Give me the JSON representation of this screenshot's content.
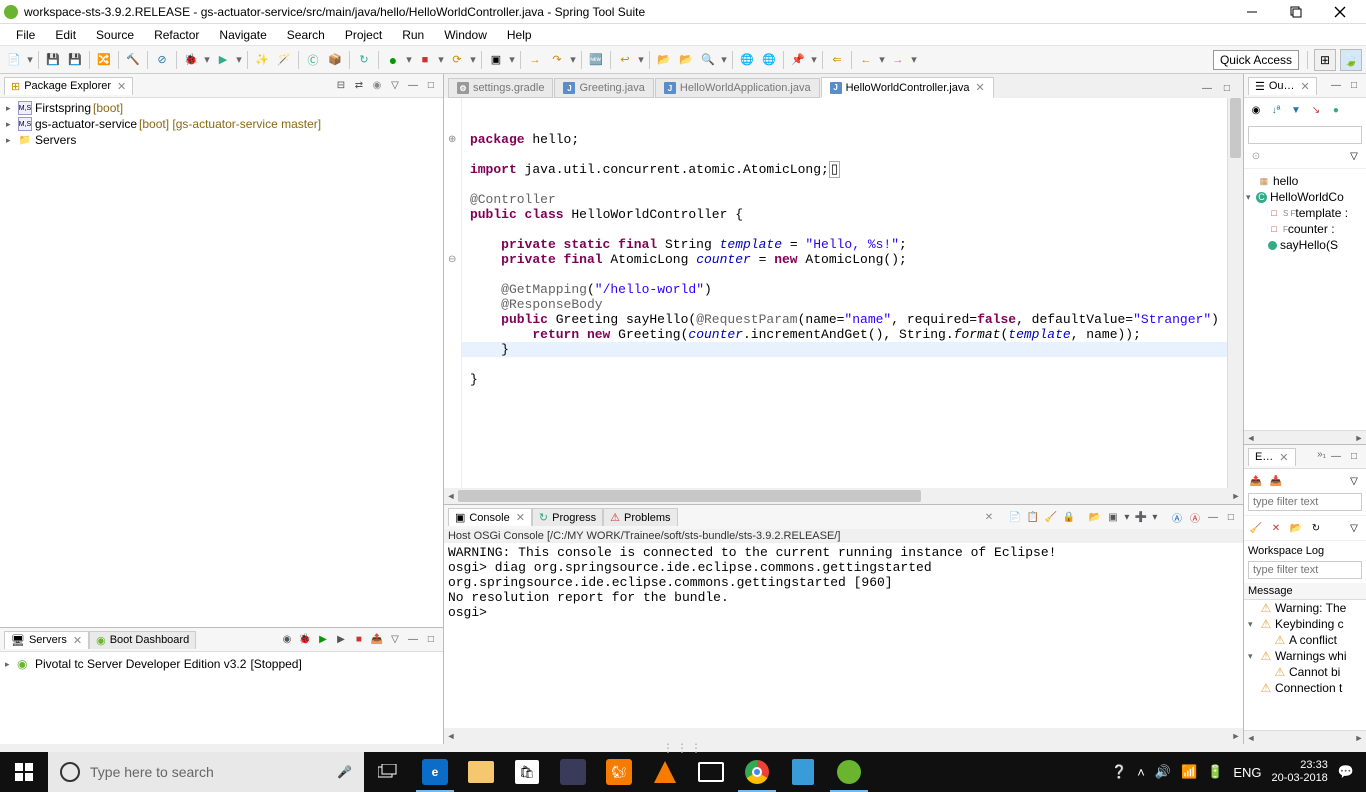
{
  "window": {
    "title": "workspace-sts-3.9.2.RELEASE - gs-actuator-service/src/main/java/hello/HelloWorldController.java - Spring Tool Suite"
  },
  "menu": [
    "File",
    "Edit",
    "Source",
    "Refactor",
    "Navigate",
    "Search",
    "Project",
    "Run",
    "Window",
    "Help"
  ],
  "quick_access": "Quick Access",
  "package_explorer": {
    "title": "Package Explorer",
    "items": [
      {
        "label": "Firstspring",
        "decorator": "[boot]"
      },
      {
        "label": "gs-actuator-service",
        "decorator": "[boot] [gs-actuator-service master]"
      },
      {
        "label": "Servers",
        "decorator": ""
      }
    ]
  },
  "servers_panel": {
    "tabs": [
      "Servers",
      "Boot Dashboard"
    ],
    "server": {
      "label": "Pivotal tc Server Developer Edition v3.2",
      "state": "[Stopped]"
    }
  },
  "editor_tabs": [
    {
      "label": "settings.gradle",
      "icon": "G",
      "active": false
    },
    {
      "label": "Greeting.java",
      "icon": "J",
      "active": false
    },
    {
      "label": "HelloWorldApplication.java",
      "icon": "J",
      "active": false
    },
    {
      "label": "HelloWorldController.java",
      "icon": "J",
      "active": true
    }
  ],
  "code": {
    "l1a": "package",
    "l1b": " hello;",
    "l3a": "import",
    "l3b": " java.util.concurrent.atomic.AtomicLong;",
    "l5": "@Controller",
    "l6a": "public class",
    "l6b": " HelloWorldController {",
    "l8a": "    private static final",
    "l8b": " String ",
    "l8c": "template",
    "l8d": " = ",
    "l8e": "\"Hello, %s!\"",
    "l8f": ";",
    "l9a": "    private final",
    "l9b": " AtomicLong ",
    "l9c": "counter",
    "l9d": " = ",
    "l9e": "new",
    "l9f": " AtomicLong();",
    "l11a": "    @GetMapping",
    "l11b": "(",
    "l11c": "\"/hello-world\"",
    "l11d": ")",
    "l12": "    @ResponseBody",
    "l13a": "    public",
    "l13b": " Greeting sayHello(",
    "l13c": "@RequestParam",
    "l13d": "(name=",
    "l13e": "\"name\"",
    "l13f": ", required=",
    "l13g": "false",
    "l13h": ", defaultValue=",
    "l13i": "\"Stranger\"",
    "l13j": ")",
    "l14a": "        return new",
    "l14b": " Greeting(",
    "l14c": "counter",
    "l14d": ".incrementAndGet(), String.",
    "l14e": "format",
    "l14f": "(",
    "l14g": "template",
    "l14h": ", name));",
    "l15": "    }",
    "l17": "}"
  },
  "console": {
    "tabs": [
      "Console",
      "Progress",
      "Problems"
    ],
    "title": "Host OSGi Console [/C:/MY WORK/Trainee/soft/sts-bundle/sts-3.9.2.RELEASE/]",
    "lines": [
      "WARNING: This console is connected to the current running instance of Eclipse!",
      "osgi> diag org.springsource.ide.eclipse.commons.gettingstarted",
      "org.springsource.ide.eclipse.commons.gettingstarted [960]",
      "  No resolution report for the bundle.",
      "osgi> "
    ]
  },
  "outline": {
    "title": "Ou…",
    "items": [
      {
        "icon": "📦",
        "label": "hello",
        "indent": 0
      },
      {
        "icon": "Θ",
        "label": "HelloWorldCo",
        "indent": 0,
        "exp": "▾"
      },
      {
        "icon": "□",
        "label": "template :",
        "indent": 1,
        "sup": "S F"
      },
      {
        "icon": "□",
        "label": "counter :",
        "indent": 1,
        "sup": "F"
      },
      {
        "icon": "●",
        "label": "sayHello(S",
        "indent": 1
      }
    ]
  },
  "errlog": {
    "title": "E…",
    "workspace_log": "Workspace Log",
    "filter_placeholder": "type filter text",
    "column": "Message",
    "items": [
      {
        "exp": "",
        "icon": "⚠",
        "label": "Warning: The"
      },
      {
        "exp": "▾",
        "icon": "⚠",
        "label": "Keybinding c"
      },
      {
        "exp": "",
        "icon": "⚠",
        "label": "A conflict",
        "indent": 1
      },
      {
        "exp": "▾",
        "icon": "⚠",
        "label": "Warnings whi"
      },
      {
        "exp": "",
        "icon": "⚠",
        "label": "Cannot bi",
        "indent": 1
      },
      {
        "exp": "",
        "icon": "⚠",
        "label": "Connection t"
      }
    ]
  },
  "taskbar": {
    "search_placeholder": "Type here to search",
    "lang": "ENG",
    "time": "23:33",
    "date": "20-03-2018"
  }
}
